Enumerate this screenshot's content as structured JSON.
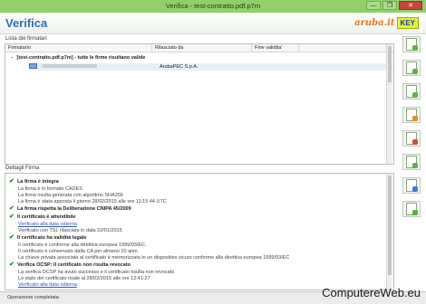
{
  "window": {
    "title": "Verifica - test-contratto.pdf.p7m",
    "controls": [
      "—",
      "❐",
      "✕"
    ]
  },
  "header": {
    "title": "Verifica",
    "logo_brand": "aruba.it",
    "logo_key": "KEY"
  },
  "signers_section": {
    "label": "Lista dei firmatari",
    "columns": [
      "Firmatario",
      "Rilasciato da",
      "Fine validita'"
    ],
    "file_row": "[test-contratto.pdf.p7m] - tutte le firme risultano valide",
    "signer_issuer": "ArubaPEC S.p.A."
  },
  "details_section": {
    "label": "Dettagli Firma",
    "lines": [
      {
        "kind": "head",
        "text": "La firma è integra"
      },
      {
        "kind": "sub",
        "text": "La firma è in formato CADES"
      },
      {
        "kind": "sub",
        "text": "La firma risulta generata con algoritmo SHA256"
      },
      {
        "kind": "sub",
        "text": "La firma è stata apposta il giorno 28/02/2015 alle ore 11:15:44 UTC"
      },
      {
        "kind": "head",
        "text": "La firma rispetta la Deliberazione CNIPA 45/2009"
      },
      {
        "kind": "head",
        "text": "Il certificato è attendibile"
      },
      {
        "kind": "link",
        "text": "Verificato alla data odierna"
      },
      {
        "kind": "sub",
        "text": "Verificato con TSL rilasciata in data 22/01/2015"
      },
      {
        "kind": "head",
        "text": "Il certificato ha validità legale"
      },
      {
        "kind": "sub",
        "text": "Il certificato è conforme alla direttiva europea 1999/93/EC."
      },
      {
        "kind": "sub",
        "text": "Il certificato è conservato dalla CA per almeno 20 anni."
      },
      {
        "kind": "sub",
        "text": "La chiave privata associata al certificato è memorizzata in un dispositivo sicuro conforme alla direttiva europea 1999/93/EC"
      },
      {
        "kind": "head",
        "text": "Verifica OCSP: Il certificato non risulta revocato"
      },
      {
        "kind": "sub",
        "text": "La verifica OCSP ha avuto successo e il certificato risulta non revocato"
      },
      {
        "kind": "sub",
        "text": "Lo stato del certificato risale al 28/02/2015 alle ore 12:41:27"
      },
      {
        "kind": "link",
        "text": "Verificato alla data odierna"
      }
    ]
  },
  "status": {
    "text": "Operazione completata"
  },
  "watermark": "ComputereWeb.eu",
  "colors": {
    "titlebar": "#8fd06a",
    "heading": "#2c6fb8",
    "ok": "#1f8c2a",
    "link": "#3555b8"
  },
  "toolbar_icons": [
    "verify-doc-icon",
    "sign-doc-icon",
    "countersign-doc-icon",
    "timestamp-doc-icon",
    "remove-signature-icon",
    "save-doc-icon",
    "print-doc-icon",
    "extract-doc-icon"
  ]
}
